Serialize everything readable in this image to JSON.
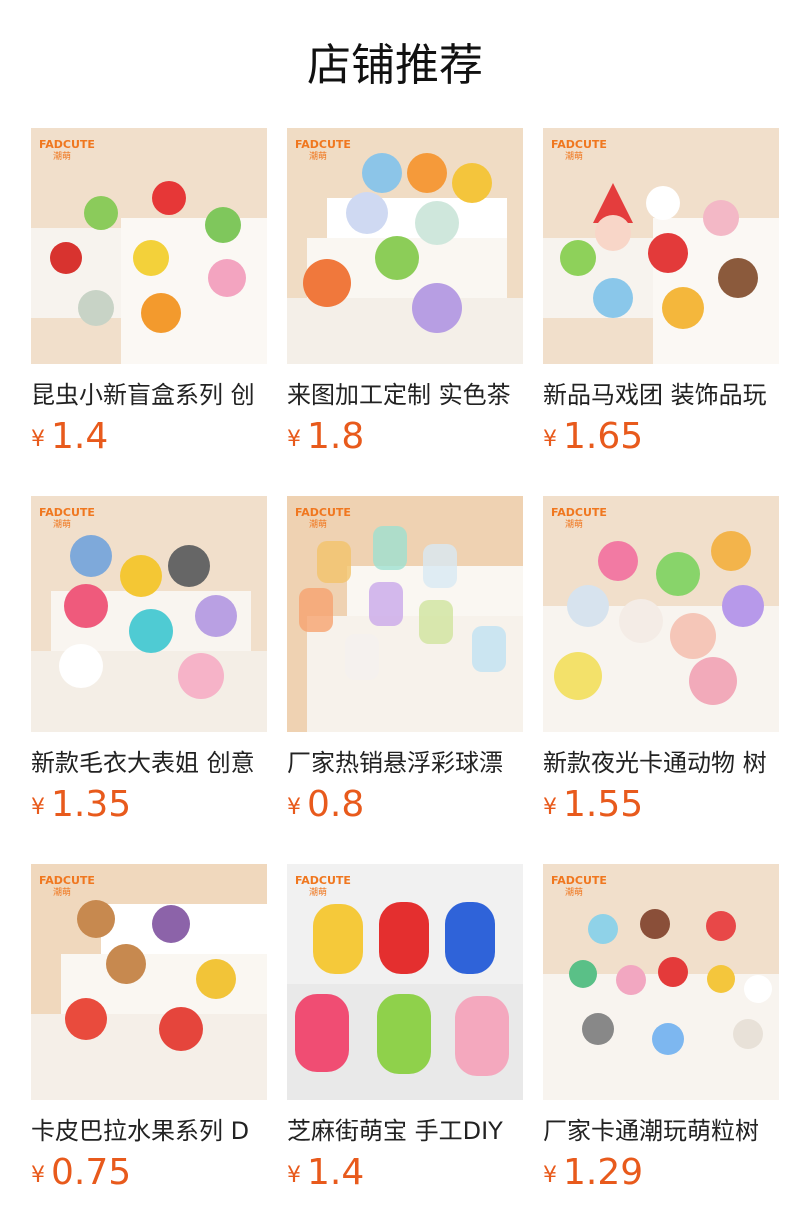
{
  "page": {
    "title": "店铺推荐"
  },
  "colors": {
    "price": "#e85a1c",
    "brand": "#f0771f"
  },
  "brand_logo": {
    "text": "FADCUTE",
    "sub": "潮萌"
  },
  "products": [
    {
      "title": "昆虫小新盲盒系列 创",
      "currency": "¥",
      "price": "1.4",
      "image": "insect-figures-photo"
    },
    {
      "title": "来图加工定制 实色茶",
      "currency": "¥",
      "price": "1.8",
      "image": "flower-hat-girls-photo"
    },
    {
      "title": "新品马戏团 装饰品玩",
      "currency": "¥",
      "price": "1.65",
      "image": "circus-figures-photo"
    },
    {
      "title": "新款毛衣大表姐 创意",
      "currency": "¥",
      "price": "1.35",
      "image": "sweater-bear-figures-photo"
    },
    {
      "title": "厂家热销悬浮彩球漂",
      "currency": "¥",
      "price": "0.8",
      "image": "jar-figures-photo"
    },
    {
      "title": "新款夜光卡通动物 树",
      "currency": "¥",
      "price": "1.55",
      "image": "glow-animal-figures-photo"
    },
    {
      "title": "卡皮巴拉水果系列 D",
      "currency": "¥",
      "price": "0.75",
      "image": "capybara-fruit-photo"
    },
    {
      "title": "芝麻街萌宝 手工DIY",
      "currency": "¥",
      "price": "1.4",
      "image": "sesame-street-figures-photo"
    },
    {
      "title": "厂家卡通潮玩萌粒树",
      "currency": "¥",
      "price": "1.29",
      "image": "cartoon-figures-photo"
    }
  ]
}
